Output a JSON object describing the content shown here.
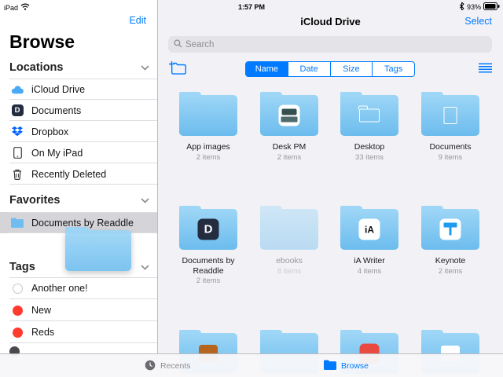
{
  "status_bar": {
    "device": "iPad",
    "time": "1:57 PM",
    "battery": "93%"
  },
  "sidebar": {
    "edit_label": "Edit",
    "title": "Browse",
    "locations": {
      "label": "Locations",
      "items": [
        {
          "label": "iCloud Drive",
          "icon": "icloud-icon"
        },
        {
          "label": "Documents",
          "icon": "documents-app-icon"
        },
        {
          "label": "Dropbox",
          "icon": "dropbox-icon"
        },
        {
          "label": "On My iPad",
          "icon": "ipad-icon"
        },
        {
          "label": "Recently Deleted",
          "icon": "trash-icon"
        }
      ]
    },
    "favorites": {
      "label": "Favorites",
      "items": [
        {
          "label": "Documents by Readdle",
          "icon": "folder-icon",
          "selected": true
        }
      ]
    },
    "tags": {
      "label": "Tags",
      "items": [
        {
          "label": "Another one!",
          "dot": "outline"
        },
        {
          "label": "New",
          "dot": "red"
        },
        {
          "label": "Reds",
          "dot": "red"
        }
      ]
    }
  },
  "main": {
    "title": "iCloud Drive",
    "select_label": "Select",
    "search_placeholder": "Search",
    "segments": [
      {
        "label": "Name",
        "selected": true
      },
      {
        "label": "Date",
        "selected": false
      },
      {
        "label": "Size",
        "selected": false
      },
      {
        "label": "Tags",
        "selected": false
      }
    ],
    "grid": [
      {
        "name": "App images",
        "count": "2 items",
        "badge": "none"
      },
      {
        "name": "Desk PM",
        "count": "2 items",
        "badge": "typewriter-icon"
      },
      {
        "name": "Desktop",
        "count": "33 items",
        "badge": "folder-outline-icon"
      },
      {
        "name": "Documents",
        "count": "9 items",
        "badge": "document-outline-icon"
      },
      {
        "name": "Documents by Readdle",
        "count": "2 items",
        "badge": "documents-app-icon",
        "badge_text": "D"
      },
      {
        "name": "ebooks",
        "count": "8 items",
        "badge": "none",
        "dimmed": true
      },
      {
        "name": "iA Writer",
        "count": "4 items",
        "badge": "ia-writer-icon",
        "badge_text": "iA"
      },
      {
        "name": "Keynote",
        "count": "2 items",
        "badge": "keynote-icon"
      }
    ],
    "badge_letters": {
      "documents_app": "D",
      "ia_writer": "iA"
    }
  },
  "tab_bar": {
    "tabs": [
      {
        "label": "Recents",
        "selected": false
      },
      {
        "label": "Browse",
        "selected": true
      }
    ]
  },
  "colors": {
    "accent": "#007aff",
    "folder_light": "#9dd6f6",
    "folder_dark": "#6cbcee",
    "tag_red": "#ff3b30",
    "selected_row": "#d5d5d9"
  }
}
